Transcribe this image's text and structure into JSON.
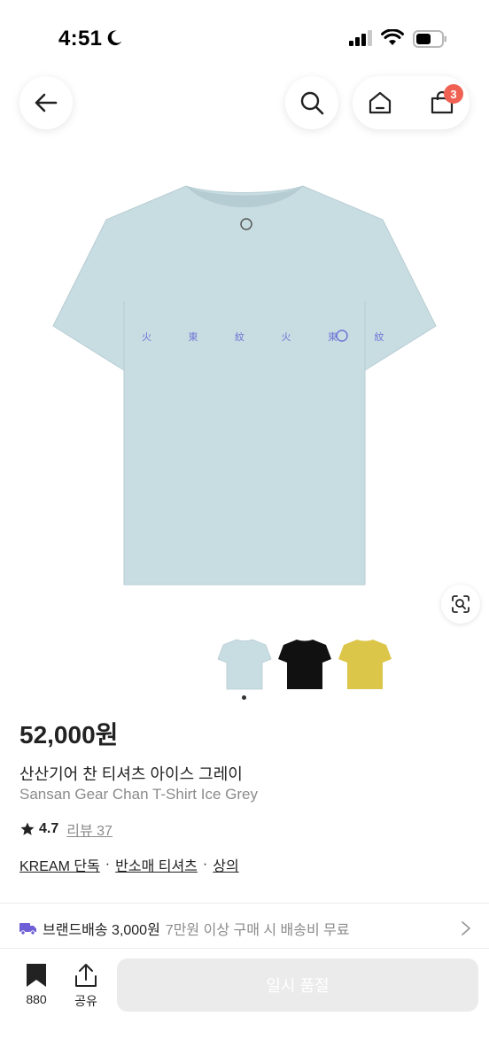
{
  "status_bar": {
    "time": "4:51",
    "icons": [
      "moon-icon",
      "cellular-signal-icon",
      "wifi-icon",
      "battery-icon"
    ]
  },
  "header": {
    "cart_count": "3",
    "icons": [
      "arrow-left-icon",
      "search-icon",
      "home-icon",
      "shopping-bag-icon"
    ]
  },
  "product": {
    "price": "52,000원",
    "name_kr": "산산기어 찬 티셔츠 아이스 그레이",
    "name_en": "Sansan Gear Chan T-Shirt Ice Grey",
    "rating": "4.7",
    "review_label": "리뷰 37",
    "print_text": "火 東 紋 火 東 紋",
    "tags": [
      "KREAM 단독",
      "반소매 티셔츠",
      "상의"
    ],
    "tag_separator": "·",
    "colors": {
      "main": "#c8dde2",
      "thumb_1": "#c8dde2",
      "thumb_2": "#111111",
      "thumb_3": "#dcc64a",
      "print": "#6d76d6"
    }
  },
  "shipping": {
    "label": "브랜드배송 3,000원",
    "condition": "7만원 이상 구매 시 배송비 무료"
  },
  "bottom_bar": {
    "bookmark_count": "880",
    "share_label": "공유",
    "cta_label": "일시 품절"
  }
}
